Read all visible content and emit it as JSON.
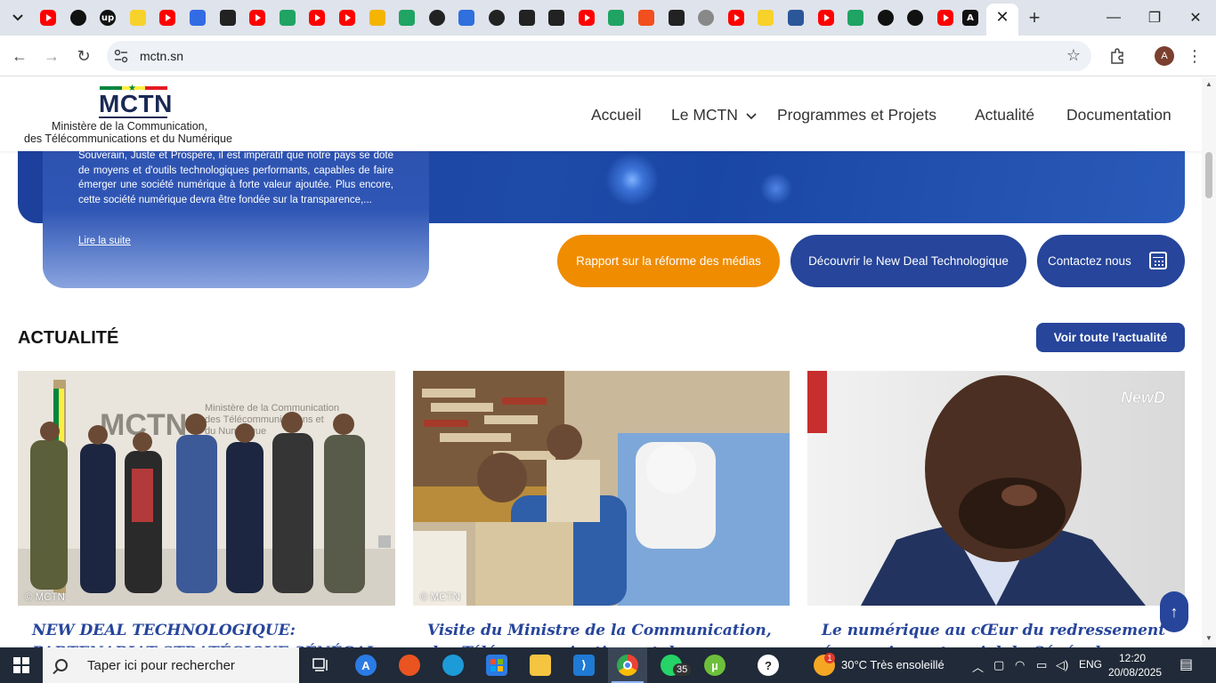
{
  "browser": {
    "tabs": [
      {
        "icon": "youtube-icon",
        "color": "#ff0000"
      },
      {
        "icon": "openai-icon",
        "color": "#111111"
      },
      {
        "icon": "upwork-icon",
        "label": "up",
        "color": "#111111"
      },
      {
        "icon": "malt-icon",
        "color": "#f7d22b"
      },
      {
        "icon": "youtube-icon",
        "color": "#ff0000"
      },
      {
        "icon": "kubernetes-icon",
        "color": "#326ce5"
      },
      {
        "icon": "agent-icon",
        "color": "#222222"
      },
      {
        "icon": "youtube-icon",
        "color": "#ff0000"
      },
      {
        "icon": "sheets-icon",
        "color": "#1fa463"
      },
      {
        "icon": "youtube-icon",
        "color": "#ff0000"
      },
      {
        "icon": "youtube-icon",
        "color": "#ff0000"
      },
      {
        "icon": "drive-icon",
        "color": "#f4b400"
      },
      {
        "icon": "sheets-icon",
        "color": "#1fa463"
      },
      {
        "icon": "github-icon",
        "color": "#222222"
      },
      {
        "icon": "cursor-icon",
        "color": "#2f6fde"
      },
      {
        "icon": "github-icon",
        "color": "#222222"
      },
      {
        "icon": "notion-icon",
        "color": "#222222"
      },
      {
        "icon": "fiverr-icon",
        "color": "#222222"
      },
      {
        "icon": "youtube-icon",
        "color": "#ff0000"
      },
      {
        "icon": "diamond-icon",
        "color": "#1fa463"
      },
      {
        "icon": "figma-icon",
        "color": "#f24e1e"
      },
      {
        "icon": "grid-icon",
        "color": "#222222"
      },
      {
        "icon": "gray-circle-icon",
        "color": "#888888"
      },
      {
        "icon": "youtube-icon",
        "color": "#ff0000"
      },
      {
        "icon": "malt-icon",
        "color": "#f7d22b"
      },
      {
        "icon": "word-icon",
        "color": "#2b579a"
      },
      {
        "icon": "youtube-icon",
        "color": "#ff0000"
      },
      {
        "icon": "leaf-icon",
        "color": "#1fa463"
      },
      {
        "icon": "triangle-icon",
        "color": "#111111"
      },
      {
        "icon": "triangle-icon",
        "color": "#111111"
      },
      {
        "icon": "youtube-icon",
        "color": "#ff0000"
      },
      {
        "icon": "a-icon",
        "color": "#111111"
      }
    ],
    "url": "mctn.sn",
    "profile_initial": "A"
  },
  "site": {
    "logo": {
      "text": "MCTN",
      "line1": "Ministère de la Communication,",
      "line2": "des Télécommunications et du Numérique",
      "flag_colors": [
        "#00853f",
        "#fdef42",
        "#e31b23"
      ]
    },
    "nav": [
      "Accueil",
      "Le MCTN",
      "Programmes et Projets",
      "Actualité",
      "Documentation"
    ],
    "hero": {
      "text": "Souverain, Juste et Prospère, il est impératif que notre pays se dote de moyens et d'outils technologiques performants, capables de faire émerger une société numérique à forte valeur ajoutée. Plus encore, cette société numérique devra être fondée sur la transparence,...",
      "link": "Lire la suite"
    },
    "buttons": {
      "report": "Rapport sur la réforme des médias",
      "new_deal": "Découvrir le New Deal Technologique",
      "contact": "Contactez nous"
    },
    "news": {
      "title": "ACTUALITÉ",
      "see_all": "Voir toute l'actualité",
      "cards": [
        {
          "credit": "© MCTN",
          "title": "NEW DEAL TECHNOLOGIQUE: PARTENARIAT STRATÉGIQUE SÉNÉGAL - BOAD"
        },
        {
          "credit": "© MCTN",
          "title": "Visite du Ministre de la Communication, des Télécommunications et du Numérique à"
        },
        {
          "credit": "",
          "title": "Le numérique au cŒur du redressement économique et social du Sénégal"
        }
      ]
    },
    "scroll_top": "↑"
  },
  "taskbar": {
    "search_placeholder": "Taper ici pour rechercher",
    "whatsapp_badge": "35",
    "weather": "30°C  Très ensoleillé",
    "weather_alert": "1",
    "language": "ENG",
    "time": "12:20",
    "date": "20/08/2025"
  }
}
